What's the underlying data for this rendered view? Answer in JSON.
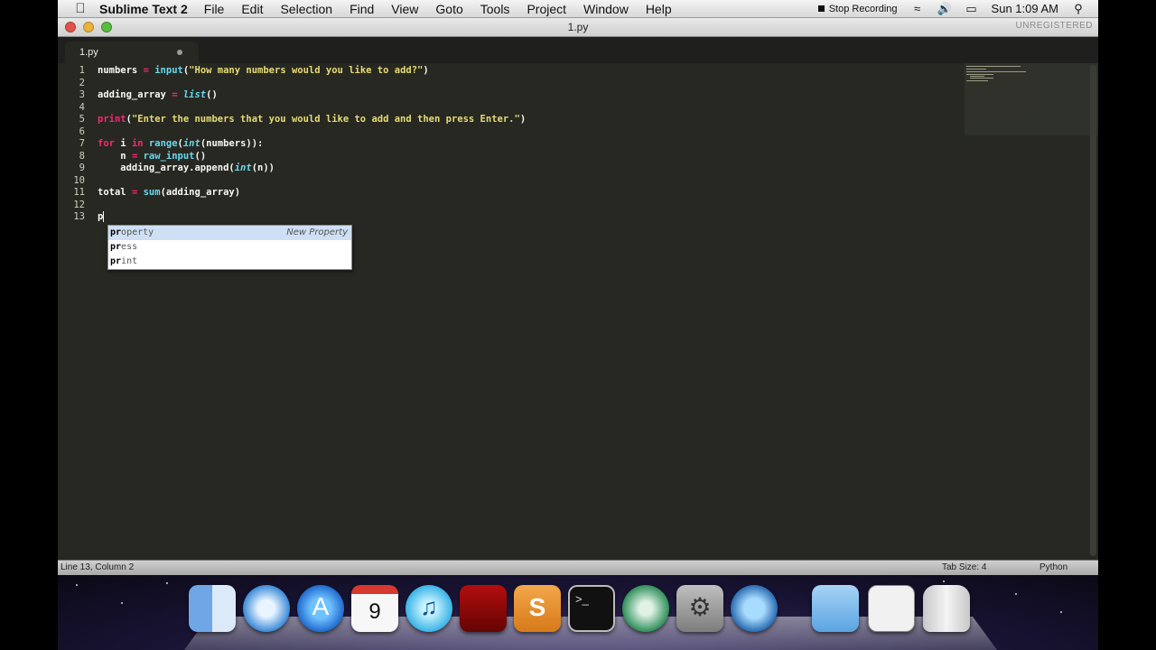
{
  "menubar": {
    "app_name": "Sublime Text 2",
    "items": [
      "File",
      "Edit",
      "Selection",
      "Find",
      "View",
      "Goto",
      "Tools",
      "Project",
      "Window",
      "Help"
    ],
    "stop_recording": "Stop Recording",
    "clock": "Sun 1:09 AM"
  },
  "window": {
    "title": "1.py",
    "unregistered": "UNREGISTERED"
  },
  "tab": {
    "label": "1.py"
  },
  "editor": {
    "line_numbers": [
      "1",
      "2",
      "3",
      "4",
      "5",
      "6",
      "7",
      "8",
      "9",
      "10",
      "11",
      "12",
      "13"
    ],
    "typed_text": "p"
  },
  "autocomplete": {
    "items": [
      {
        "match": "pr",
        "rest": "operty",
        "hint": "New Property"
      },
      {
        "match": "pr",
        "rest": "ess",
        "hint": ""
      },
      {
        "match": "pr",
        "rest": "int",
        "hint": ""
      }
    ]
  },
  "statusbar": {
    "position": "Line 13, Column 2",
    "tab_size": "Tab Size: 4",
    "syntax": "Python"
  },
  "dock": {
    "icons": [
      "finder-icon",
      "safari-icon",
      "app-store-icon",
      "calendar-icon",
      "itunes-icon",
      "photo-booth-icon",
      "sublime-text-icon",
      "terminal-icon",
      "time-machine-icon",
      "system-preferences-icon",
      "quicktime-icon",
      "folder-icon",
      "window-preview-icon",
      "trash-icon"
    ],
    "calendar_day": "9"
  },
  "colors": {
    "editor_bg": "#272822",
    "keyword": "#f92672",
    "function": "#66d9ef",
    "string": "#e6db74",
    "text": "#f8f8f2"
  }
}
